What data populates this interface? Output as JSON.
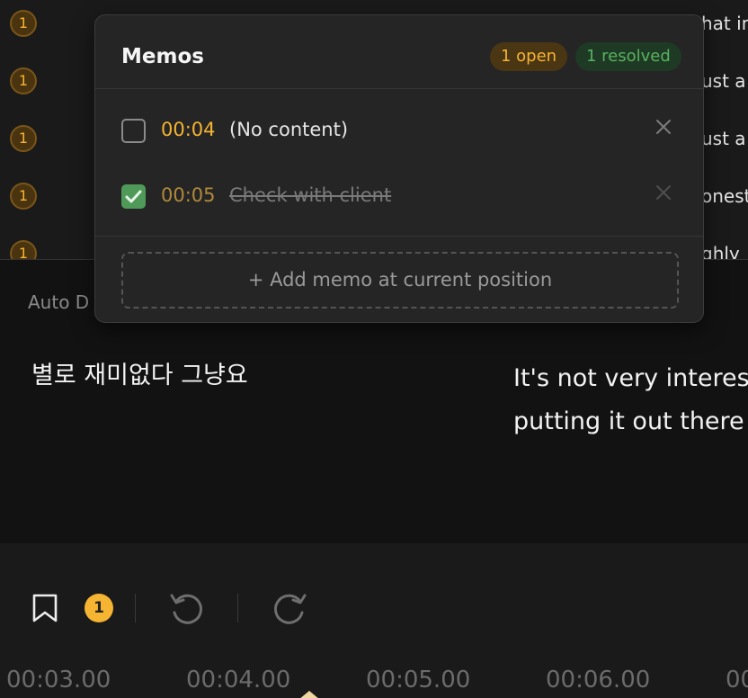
{
  "subtitle_list": {
    "rows": [
      {
        "badge": "1",
        "text": "hat in"
      },
      {
        "badge": "1",
        "text": "ust a"
      },
      {
        "badge": "1",
        "text": "ust a"
      },
      {
        "badge": "1",
        "text": "onest"
      },
      {
        "badge": "1",
        "text": "ghly"
      }
    ]
  },
  "detail": {
    "auto_label": "Auto D",
    "source_text": "별로 재미없다 그냥요",
    "target_line1": "It's not very interes",
    "target_line2": "putting it out there"
  },
  "memo_popup": {
    "title": "Memos",
    "open_count": "1 open",
    "resolved_count": "1 resolved",
    "memos": [
      {
        "time": "00:04",
        "content": "(No content)",
        "resolved": false
      },
      {
        "time": "00:05",
        "content": "Check with client",
        "resolved": true
      }
    ],
    "add_label": "+ Add memo at current position"
  },
  "toolbar": {
    "memo_count": "1",
    "icons": [
      "bookmark-icon",
      "undo-icon",
      "redo-icon"
    ]
  },
  "timeline": {
    "ticks": [
      "00:03.00",
      "00:04.00",
      "00:05.00",
      "00:06.00",
      "00"
    ]
  },
  "colors": {
    "accent": "#f5b431",
    "resolved": "#57b15f",
    "background": "#121212"
  }
}
